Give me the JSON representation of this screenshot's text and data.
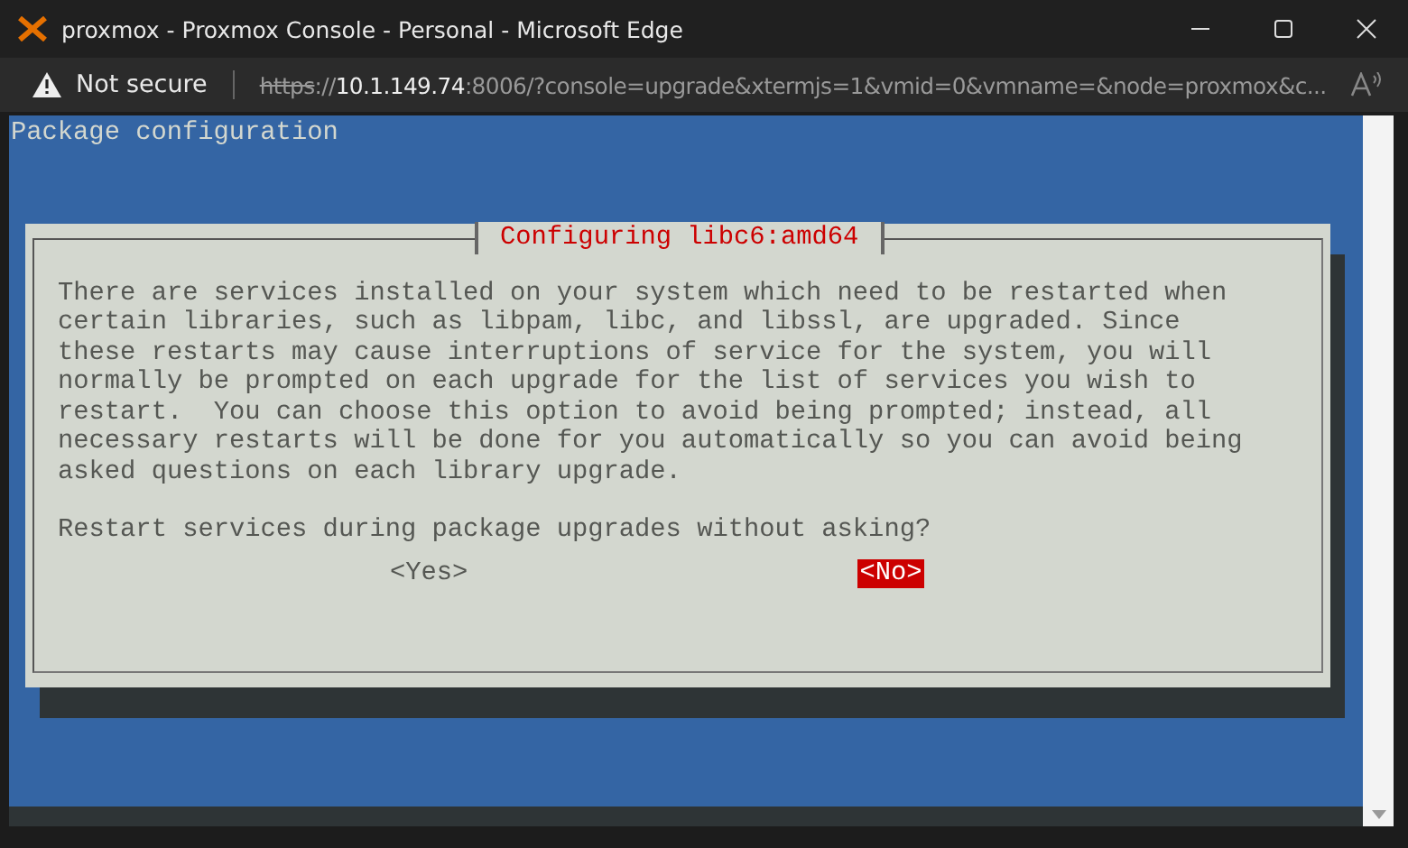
{
  "window": {
    "title": "proxmox - Proxmox Console - Personal - Microsoft Edge"
  },
  "address_bar": {
    "security": "Not secure",
    "url_scheme": "https",
    "url_separator": "://",
    "url_host": "10.1.149.74",
    "url_rest": ":8006/?console=upgrade&xtermjs=1&vmid=0&vmname=&node=proxmox&c..."
  },
  "terminal": {
    "header": "Package configuration",
    "dialog": {
      "title": "Configuring libc6:amd64",
      "body": [
        "There are services installed on your system which need to be restarted when",
        "certain libraries, such as libpam, libc, and libssl, are upgraded. Since",
        "these restarts may cause interruptions of service for the system, you will",
        "normally be prompted on each upgrade for the list of services you wish to",
        "restart.  You can choose this option to avoid being prompted; instead, all",
        "necessary restarts will be done for you automatically so you can avoid being",
        "asked questions on each library upgrade."
      ],
      "question": "Restart services during package upgrades without asking?",
      "buttons": [
        {
          "label": "<Yes>",
          "selected": false
        },
        {
          "label": "<No>",
          "selected": true
        }
      ]
    }
  }
}
